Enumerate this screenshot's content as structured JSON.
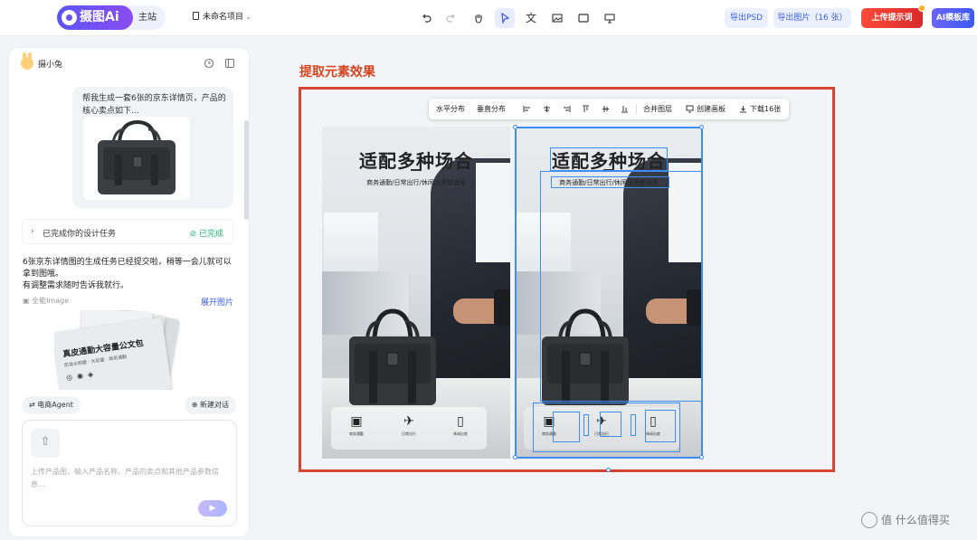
{
  "app": {
    "logo_text": "摄图Ai",
    "site_label": "主站",
    "project_name": "未命名项目"
  },
  "header_actions": {
    "export_psd": "导出PSD",
    "export_images": "导出图片（16 张）",
    "upload_prompt": "上传提示词",
    "ai_templates": "AI模板库",
    "text_tool_glyph": "文"
  },
  "left_panel": {
    "assistant_name": "摄小兔",
    "user_prompt": "帮我生成一套6张的京东详情页，产品的核心卖点如下...",
    "task_label": "已完成你的设计任务",
    "task_status": "已完成",
    "result_message_line1": "6张京东详情图的生成任务已经提交啦，稍等一会儿就可以拿到图哦。",
    "result_message_line2": "有调整需求随时告诉我就行。",
    "image_tag": "全能Image",
    "expand_images": "展开图片",
    "stack_card_title": "真皮通勤大容量公文包",
    "stack_card_sub": "防泼水耐磨 · 大容量 · 商务通勤",
    "agent_button": "电商Agent",
    "new_chat": "新建对话",
    "input_placeholder": "上传产品图，输入产品名称、产品的卖点和其他产品参数信息...",
    "colors": {
      "accent": "#3f5be8",
      "done": "#25b474"
    }
  },
  "canvas": {
    "title": "提取元素效果",
    "toolbar": {
      "h_distribute": "水平分布",
      "v_distribute": "垂直分布",
      "merge_layers": "合并图层",
      "create_artboard": "创建画板",
      "download": "下载16张"
    },
    "poster_left": {
      "headline": "适配多种场合",
      "subline": "商务通勤/日常出行/休闲出差都适用",
      "icons": [
        {
          "icon": "briefcase-icon",
          "label": "商务通勤"
        },
        {
          "icon": "airplane-icon",
          "label": "日常出行"
        },
        {
          "icon": "luggage-icon",
          "label": "休闲出差"
        }
      ]
    },
    "poster_right": {
      "headline": "适配多种场合",
      "subline": "商务通勤/日常出行/休闲出差都适用",
      "icons": [
        {
          "icon": "briefcase-icon",
          "label": "商务通勤"
        },
        {
          "icon": "airplane-icon",
          "label": "日常出行"
        },
        {
          "icon": "luggage-icon",
          "label": "休闲出差"
        }
      ]
    },
    "frame_color": "#d64530",
    "selection_color": "#3d8ef0"
  },
  "watermark": "值 什么值得买"
}
